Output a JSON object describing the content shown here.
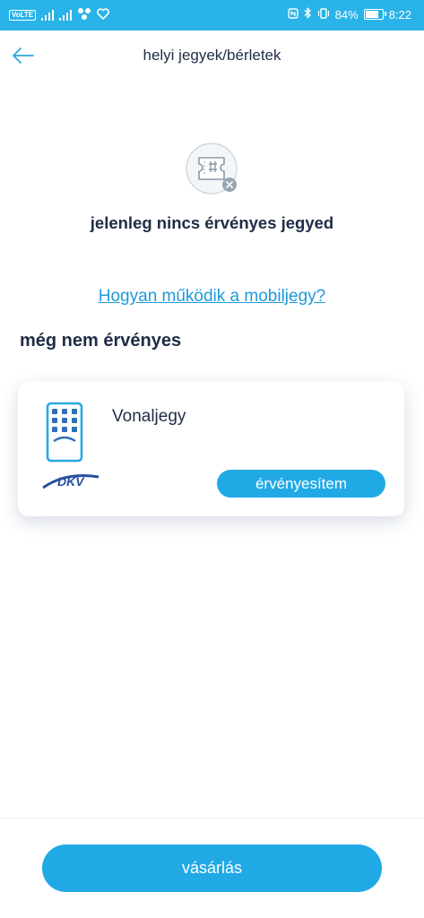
{
  "status_bar": {
    "network_badge": "VoLTE",
    "battery": "84%",
    "battery_level": 0.84,
    "time": "8:22"
  },
  "header": {
    "title": "helyi jegyek/bérletek",
    "back_icon": "arrow-left-icon"
  },
  "empty_state": {
    "icon": "ticket-cancel-icon",
    "message": "jelenleg nincs érvényes jegyed"
  },
  "help_link": "Hogyan működik a mobiljegy?",
  "section_title": "még nem érvényes",
  "tickets": [
    {
      "name": "Vonaljegy",
      "icon": "mobile-ticket-icon",
      "operator_logo": "DKV",
      "action_label": "érvényesítem"
    }
  ],
  "buy_button": "vásárlás",
  "colors": {
    "accent": "#21a9e6",
    "status_bar": "#29b3e8",
    "text_dark": "#1f2c46",
    "link": "#1f9ad8"
  }
}
